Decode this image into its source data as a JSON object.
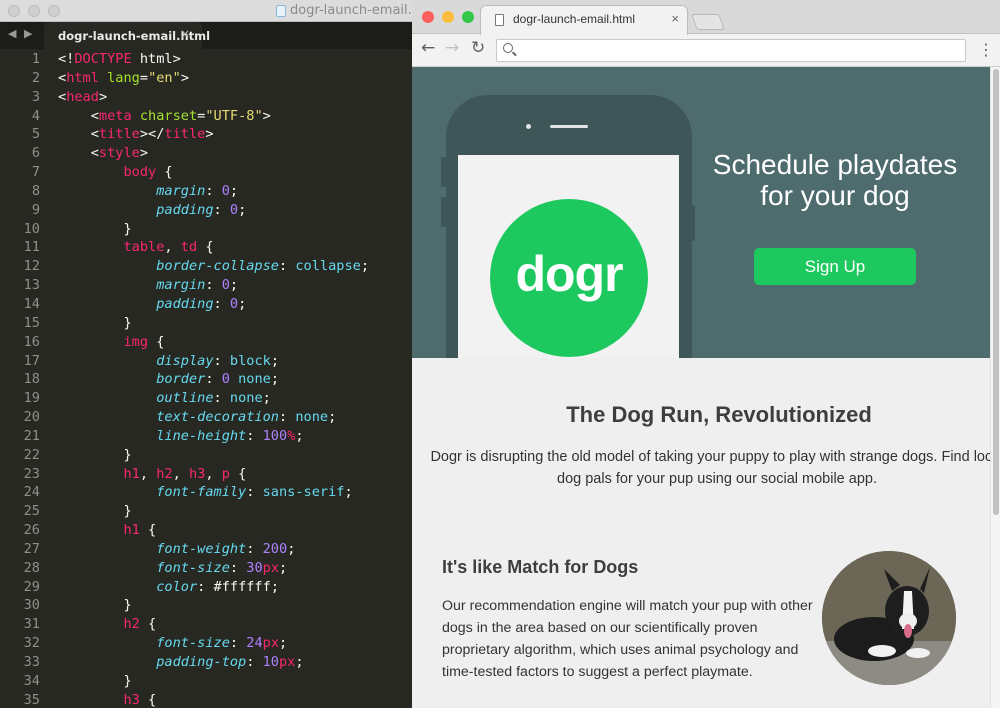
{
  "editor": {
    "window_title": "dogr-launch-email.html",
    "tab_label": "dogr-launch-email.html",
    "tab_close": "×",
    "nav_arrows": "◀ ▶",
    "lines": [
      {
        "n": "1",
        "code": [
          [
            "t-p",
            "<!"
          ],
          [
            "t-tag",
            "DOCTYPE"
          ],
          [
            "t-p",
            " html>"
          ]
        ]
      },
      {
        "n": "2",
        "code": [
          [
            "t-p",
            "<"
          ],
          [
            "t-tag",
            "html"
          ],
          [
            "t-p",
            " "
          ],
          [
            "t-attr",
            "lang"
          ],
          [
            "t-p",
            "="
          ],
          [
            "t-str",
            "\"en\""
          ],
          [
            "t-p",
            ">"
          ]
        ]
      },
      {
        "n": "3",
        "code": [
          [
            "t-p",
            "<"
          ],
          [
            "t-tag",
            "head"
          ],
          [
            "t-p",
            ">"
          ]
        ]
      },
      {
        "n": "4",
        "code": [
          [
            "t-p",
            "    <"
          ],
          [
            "t-tag",
            "meta"
          ],
          [
            "t-p",
            " "
          ],
          [
            "t-attr",
            "charset"
          ],
          [
            "t-p",
            "="
          ],
          [
            "t-str",
            "\"UTF-8\""
          ],
          [
            "t-p",
            ">"
          ]
        ]
      },
      {
        "n": "5",
        "code": [
          [
            "t-p",
            "    <"
          ],
          [
            "t-tag",
            "title"
          ],
          [
            "t-p",
            "></"
          ],
          [
            "t-tag",
            "title"
          ],
          [
            "t-p",
            ">"
          ]
        ]
      },
      {
        "n": "6",
        "code": [
          [
            "t-p",
            "    <"
          ],
          [
            "t-tag",
            "style"
          ],
          [
            "t-p",
            ">"
          ]
        ]
      },
      {
        "n": "7",
        "code": [
          [
            "t-p",
            "        "
          ],
          [
            "t-tag",
            "body"
          ],
          [
            "t-p",
            " {"
          ]
        ]
      },
      {
        "n": "8",
        "code": [
          [
            "t-p",
            "            "
          ],
          [
            "t-prop",
            "margin"
          ],
          [
            "t-p",
            ": "
          ],
          [
            "t-num",
            "0"
          ],
          [
            "t-p",
            ";"
          ]
        ]
      },
      {
        "n": "9",
        "code": [
          [
            "t-p",
            "            "
          ],
          [
            "t-prop",
            "padding"
          ],
          [
            "t-p",
            ": "
          ],
          [
            "t-num",
            "0"
          ],
          [
            "t-p",
            ";"
          ]
        ]
      },
      {
        "n": "10",
        "code": [
          [
            "t-p",
            "        }"
          ]
        ]
      },
      {
        "n": "11",
        "code": [
          [
            "t-p",
            "        "
          ],
          [
            "t-tag",
            "table"
          ],
          [
            "t-p",
            ", "
          ],
          [
            "t-tag",
            "td"
          ],
          [
            "t-p",
            " {"
          ]
        ]
      },
      {
        "n": "12",
        "code": [
          [
            "t-p",
            "            "
          ],
          [
            "t-prop",
            "border-collapse"
          ],
          [
            "t-p",
            ": "
          ],
          [
            "t-val",
            "collapse"
          ],
          [
            "t-p",
            ";"
          ]
        ]
      },
      {
        "n": "13",
        "code": [
          [
            "t-p",
            "            "
          ],
          [
            "t-prop",
            "margin"
          ],
          [
            "t-p",
            ": "
          ],
          [
            "t-num",
            "0"
          ],
          [
            "t-p",
            ";"
          ]
        ]
      },
      {
        "n": "14",
        "code": [
          [
            "t-p",
            "            "
          ],
          [
            "t-prop",
            "padding"
          ],
          [
            "t-p",
            ": "
          ],
          [
            "t-num",
            "0"
          ],
          [
            "t-p",
            ";"
          ]
        ]
      },
      {
        "n": "15",
        "code": [
          [
            "t-p",
            "        }"
          ]
        ]
      },
      {
        "n": "16",
        "code": [
          [
            "t-p",
            "        "
          ],
          [
            "t-tag",
            "img"
          ],
          [
            "t-p",
            " {"
          ]
        ]
      },
      {
        "n": "17",
        "code": [
          [
            "t-p",
            "            "
          ],
          [
            "t-prop",
            "display"
          ],
          [
            "t-p",
            ": "
          ],
          [
            "t-val",
            "block"
          ],
          [
            "t-p",
            ";"
          ]
        ]
      },
      {
        "n": "18",
        "code": [
          [
            "t-p",
            "            "
          ],
          [
            "t-prop",
            "border"
          ],
          [
            "t-p",
            ": "
          ],
          [
            "t-num",
            "0"
          ],
          [
            "t-p",
            " "
          ],
          [
            "t-val",
            "none"
          ],
          [
            "t-p",
            ";"
          ]
        ]
      },
      {
        "n": "19",
        "code": [
          [
            "t-p",
            "            "
          ],
          [
            "t-prop",
            "outline"
          ],
          [
            "t-p",
            ": "
          ],
          [
            "t-val",
            "none"
          ],
          [
            "t-p",
            ";"
          ]
        ]
      },
      {
        "n": "20",
        "code": [
          [
            "t-p",
            "            "
          ],
          [
            "t-prop",
            "text-decoration"
          ],
          [
            "t-p",
            ": "
          ],
          [
            "t-val",
            "none"
          ],
          [
            "t-p",
            ";"
          ]
        ]
      },
      {
        "n": "21",
        "code": [
          [
            "t-p",
            "            "
          ],
          [
            "t-prop",
            "line-height"
          ],
          [
            "t-p",
            ": "
          ],
          [
            "t-num",
            "100"
          ],
          [
            "t-tag",
            "%"
          ],
          [
            "t-p",
            ";"
          ]
        ]
      },
      {
        "n": "22",
        "code": [
          [
            "t-p",
            "        }"
          ]
        ]
      },
      {
        "n": "23",
        "code": [
          [
            "t-p",
            "        "
          ],
          [
            "t-tag",
            "h1"
          ],
          [
            "t-p",
            ", "
          ],
          [
            "t-tag",
            "h2"
          ],
          [
            "t-p",
            ", "
          ],
          [
            "t-tag",
            "h3"
          ],
          [
            "t-p",
            ", "
          ],
          [
            "t-tag",
            "p"
          ],
          [
            "t-p",
            " {"
          ]
        ]
      },
      {
        "n": "24",
        "code": [
          [
            "t-p",
            "            "
          ],
          [
            "t-prop",
            "font-family"
          ],
          [
            "t-p",
            ": "
          ],
          [
            "t-val",
            "sans-serif"
          ],
          [
            "t-p",
            ";"
          ]
        ]
      },
      {
        "n": "25",
        "code": [
          [
            "t-p",
            "        }"
          ]
        ]
      },
      {
        "n": "26",
        "code": [
          [
            "t-p",
            "        "
          ],
          [
            "t-tag",
            "h1"
          ],
          [
            "t-p",
            " {"
          ]
        ]
      },
      {
        "n": "27",
        "code": [
          [
            "t-p",
            "            "
          ],
          [
            "t-prop",
            "font-weight"
          ],
          [
            "t-p",
            ": "
          ],
          [
            "t-num",
            "200"
          ],
          [
            "t-p",
            ";"
          ]
        ]
      },
      {
        "n": "28",
        "code": [
          [
            "t-p",
            "            "
          ],
          [
            "t-prop",
            "font-size"
          ],
          [
            "t-p",
            ": "
          ],
          [
            "t-num",
            "30"
          ],
          [
            "t-tag",
            "px"
          ],
          [
            "t-p",
            ";"
          ]
        ]
      },
      {
        "n": "29",
        "code": [
          [
            "t-p",
            "            "
          ],
          [
            "t-prop",
            "color"
          ],
          [
            "t-p",
            ": "
          ],
          [
            "t-p",
            "#ffffff"
          ],
          [
            "t-p",
            ";"
          ]
        ]
      },
      {
        "n": "30",
        "code": [
          [
            "t-p",
            "        }"
          ]
        ]
      },
      {
        "n": "31",
        "code": [
          [
            "t-p",
            "        "
          ],
          [
            "t-tag",
            "h2"
          ],
          [
            "t-p",
            " {"
          ]
        ]
      },
      {
        "n": "32",
        "code": [
          [
            "t-p",
            "            "
          ],
          [
            "t-prop",
            "font-size"
          ],
          [
            "t-p",
            ": "
          ],
          [
            "t-num",
            "24"
          ],
          [
            "t-tag",
            "px"
          ],
          [
            "t-p",
            ";"
          ]
        ]
      },
      {
        "n": "33",
        "code": [
          [
            "t-p",
            "            "
          ],
          [
            "t-prop",
            "padding-top"
          ],
          [
            "t-p",
            ": "
          ],
          [
            "t-num",
            "10"
          ],
          [
            "t-tag",
            "px"
          ],
          [
            "t-p",
            ";"
          ]
        ]
      },
      {
        "n": "34",
        "code": [
          [
            "t-p",
            "        }"
          ]
        ]
      },
      {
        "n": "35",
        "code": [
          [
            "t-p",
            "        "
          ],
          [
            "t-tag",
            "h3"
          ],
          [
            "t-p",
            " {"
          ]
        ]
      }
    ]
  },
  "browser": {
    "tab_label": "dogr-launch-email.html",
    "tab_close": "×",
    "nav_back": "←",
    "nav_forward": "→",
    "nav_reload": "↻",
    "menu": "⋮",
    "address_value": "",
    "traffic_lights": {
      "close": "#fc605c",
      "minimize": "#fdbc40",
      "zoom": "#34c84a"
    }
  },
  "page": {
    "logo": "dogr",
    "hero_headline": "Schedule playdates for your dog",
    "signup_label": "Sign Up",
    "intro_title": "The Dog Run, Revolutionized",
    "intro_body": "Dogr is disrupting the old model of taking your puppy to play with strange dogs. Find local dog pals for your pup using our social mobile app.",
    "feature_title": "It's like Match for Dogs",
    "feature_body": "Our recommendation engine will match your pup with other dogs in the area based on our scientifically proven proprietary algorithm, which uses animal psychology and time-tested factors to suggest a perfect playmate.",
    "colors": {
      "hero_bg": "#4e6b6e",
      "brand_green": "#1dc95f"
    }
  }
}
